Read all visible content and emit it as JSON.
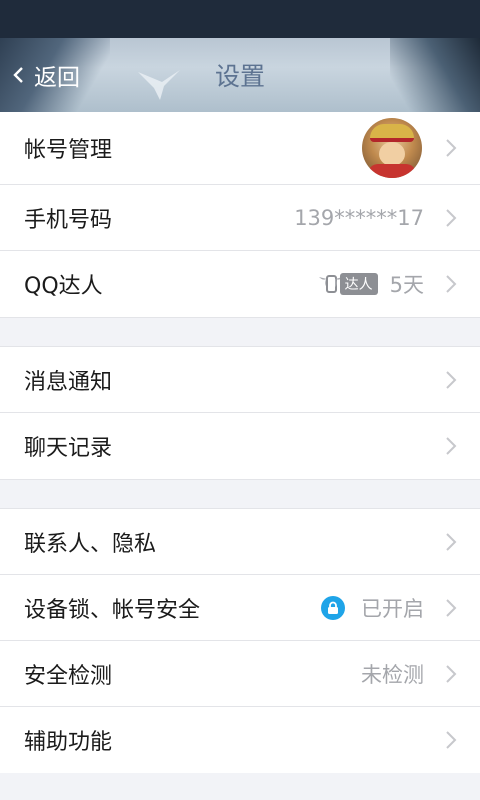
{
  "header": {
    "back_label": "返回",
    "title": "设置"
  },
  "sections": [
    {
      "rows": [
        {
          "label": "帐号管理",
          "value": "",
          "right_icon": "avatar"
        },
        {
          "label": "手机号码",
          "value": "139******17"
        },
        {
          "label": "QQ达人",
          "badge_text": "达人",
          "value": "5天"
        }
      ]
    },
    {
      "rows": [
        {
          "label": "消息通知",
          "value": ""
        },
        {
          "label": "聊天记录",
          "value": ""
        }
      ]
    },
    {
      "rows": [
        {
          "label": "联系人、隐私",
          "value": ""
        },
        {
          "label": "设备锁、帐号安全",
          "value": "已开启",
          "right_icon": "lock-icon"
        },
        {
          "label": "安全检测",
          "value": "未检测"
        },
        {
          "label": "辅助功能",
          "value": ""
        }
      ]
    }
  ],
  "colors": {
    "status_bar": "#1f2b3b",
    "title_text": "#5d7391",
    "value_text": "#a4a6ab",
    "lock_blue": "#1fa4e8",
    "background": "#f2f3f7"
  }
}
